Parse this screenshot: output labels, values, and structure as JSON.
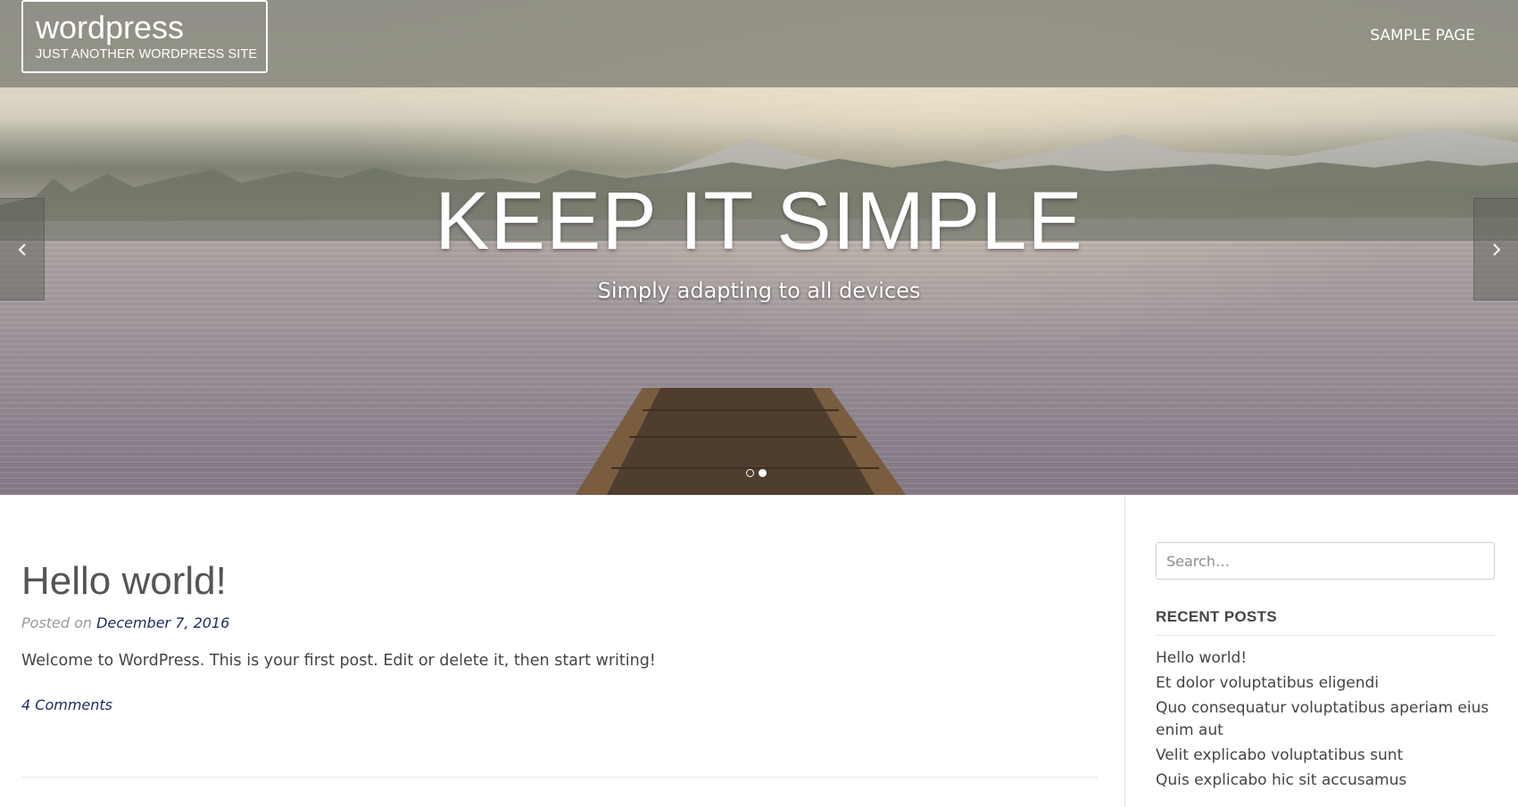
{
  "header": {
    "site_title": "wordpress",
    "tagline": "JUST ANOTHER WORDPRESS SITE",
    "nav": [
      {
        "label": "SAMPLE PAGE"
      }
    ]
  },
  "hero": {
    "title": "KEEP IT SIMPLE",
    "subtitle": "Simply adapting to all devices",
    "slides_total": 2,
    "active_slide": 2,
    "prev_icon": "chevron-left-icon",
    "next_icon": "chevron-right-icon"
  },
  "post": {
    "title": "Hello world!",
    "posted_on_label": "Posted on",
    "date": "December 7, 2016",
    "excerpt": "Welcome to WordPress. This is your first post. Edit or delete it, then start writing!",
    "comments": "4 Comments"
  },
  "sidebar": {
    "search": {
      "placeholder": "Search…"
    },
    "recent_posts": {
      "title": "RECENT POSTS",
      "items": [
        {
          "label": "Hello world!"
        },
        {
          "label": "Et dolor voluptatibus eligendi"
        },
        {
          "label": "Quo consequatur voluptatibus aperiam eius enim aut"
        },
        {
          "label": "Velit explicabo voluptatibus sunt"
        },
        {
          "label": "Quis explicabo hic sit accusamus"
        }
      ]
    }
  },
  "colors": {
    "link": "#1b2a57",
    "text": "#444444",
    "meta": "#9a9a9a",
    "header_overlay": "#787870"
  }
}
